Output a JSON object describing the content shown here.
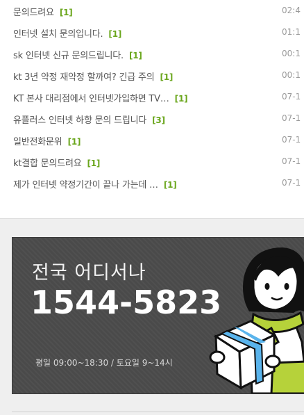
{
  "posts": [
    {
      "title": "문의드려요",
      "count": "[1]",
      "time": "02:4"
    },
    {
      "title": "인터넷 설치 문의입니다.",
      "count": "[1]",
      "time": "01:1"
    },
    {
      "title": "sk 인터넷 신규 문의드립니다.",
      "count": "[1]",
      "time": "00:1"
    },
    {
      "title": "kt 3년 약정 재약정 할까여? 긴급 주의",
      "count": "[1]",
      "time": "00:1"
    },
    {
      "title": "KT 본사 대리점에서 인터넷가입하면 TV…",
      "count": "[1]",
      "time": "07-1"
    },
    {
      "title": "유플러스 인터넷 하향 문의 드립니다",
      "count": "[3]",
      "time": "07-1"
    },
    {
      "title": "일반전화문위",
      "count": "[1]",
      "time": "07-1"
    },
    {
      "title": "kt결합 문의드려요",
      "count": "[1]",
      "time": "07-1"
    },
    {
      "title": "제가 인터넷 약정기간이 끝나 가는데 …",
      "count": "[1]",
      "time": "07-1"
    }
  ],
  "banner": {
    "headline": "전국 어디서나",
    "phone": "1544-5823",
    "hours": "평일 09:00~18:30 / 토요일 9~14시",
    "illustration": "delivery-person-with-box-icon"
  },
  "colors": {
    "count": "#6aa61c",
    "banner_bg": "#4a4a4a",
    "box": "#5ab4ec",
    "scarf": "#b6d23a"
  }
}
